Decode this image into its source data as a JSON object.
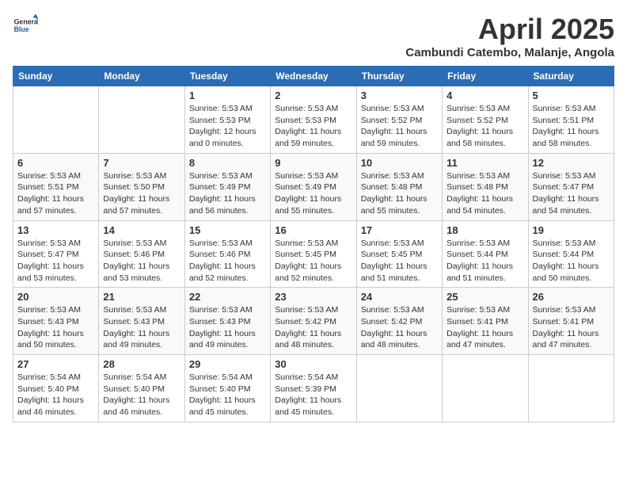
{
  "logo": {
    "general": "General",
    "blue": "Blue"
  },
  "title": "April 2025",
  "subtitle": "Cambundi Catembo, Malanje, Angola",
  "days_of_week": [
    "Sunday",
    "Monday",
    "Tuesday",
    "Wednesday",
    "Thursday",
    "Friday",
    "Saturday"
  ],
  "weeks": [
    [
      {
        "day": "",
        "sunrise": "",
        "sunset": "",
        "daylight": ""
      },
      {
        "day": "",
        "sunrise": "",
        "sunset": "",
        "daylight": ""
      },
      {
        "day": "1",
        "sunrise": "Sunrise: 5:53 AM",
        "sunset": "Sunset: 5:53 PM",
        "daylight": "Daylight: 12 hours and 0 minutes."
      },
      {
        "day": "2",
        "sunrise": "Sunrise: 5:53 AM",
        "sunset": "Sunset: 5:53 PM",
        "daylight": "Daylight: 11 hours and 59 minutes."
      },
      {
        "day": "3",
        "sunrise": "Sunrise: 5:53 AM",
        "sunset": "Sunset: 5:52 PM",
        "daylight": "Daylight: 11 hours and 59 minutes."
      },
      {
        "day": "4",
        "sunrise": "Sunrise: 5:53 AM",
        "sunset": "Sunset: 5:52 PM",
        "daylight": "Daylight: 11 hours and 58 minutes."
      },
      {
        "day": "5",
        "sunrise": "Sunrise: 5:53 AM",
        "sunset": "Sunset: 5:51 PM",
        "daylight": "Daylight: 11 hours and 58 minutes."
      }
    ],
    [
      {
        "day": "6",
        "sunrise": "Sunrise: 5:53 AM",
        "sunset": "Sunset: 5:51 PM",
        "daylight": "Daylight: 11 hours and 57 minutes."
      },
      {
        "day": "7",
        "sunrise": "Sunrise: 5:53 AM",
        "sunset": "Sunset: 5:50 PM",
        "daylight": "Daylight: 11 hours and 57 minutes."
      },
      {
        "day": "8",
        "sunrise": "Sunrise: 5:53 AM",
        "sunset": "Sunset: 5:49 PM",
        "daylight": "Daylight: 11 hours and 56 minutes."
      },
      {
        "day": "9",
        "sunrise": "Sunrise: 5:53 AM",
        "sunset": "Sunset: 5:49 PM",
        "daylight": "Daylight: 11 hours and 55 minutes."
      },
      {
        "day": "10",
        "sunrise": "Sunrise: 5:53 AM",
        "sunset": "Sunset: 5:48 PM",
        "daylight": "Daylight: 11 hours and 55 minutes."
      },
      {
        "day": "11",
        "sunrise": "Sunrise: 5:53 AM",
        "sunset": "Sunset: 5:48 PM",
        "daylight": "Daylight: 11 hours and 54 minutes."
      },
      {
        "day": "12",
        "sunrise": "Sunrise: 5:53 AM",
        "sunset": "Sunset: 5:47 PM",
        "daylight": "Daylight: 11 hours and 54 minutes."
      }
    ],
    [
      {
        "day": "13",
        "sunrise": "Sunrise: 5:53 AM",
        "sunset": "Sunset: 5:47 PM",
        "daylight": "Daylight: 11 hours and 53 minutes."
      },
      {
        "day": "14",
        "sunrise": "Sunrise: 5:53 AM",
        "sunset": "Sunset: 5:46 PM",
        "daylight": "Daylight: 11 hours and 53 minutes."
      },
      {
        "day": "15",
        "sunrise": "Sunrise: 5:53 AM",
        "sunset": "Sunset: 5:46 PM",
        "daylight": "Daylight: 11 hours and 52 minutes."
      },
      {
        "day": "16",
        "sunrise": "Sunrise: 5:53 AM",
        "sunset": "Sunset: 5:45 PM",
        "daylight": "Daylight: 11 hours and 52 minutes."
      },
      {
        "day": "17",
        "sunrise": "Sunrise: 5:53 AM",
        "sunset": "Sunset: 5:45 PM",
        "daylight": "Daylight: 11 hours and 51 minutes."
      },
      {
        "day": "18",
        "sunrise": "Sunrise: 5:53 AM",
        "sunset": "Sunset: 5:44 PM",
        "daylight": "Daylight: 11 hours and 51 minutes."
      },
      {
        "day": "19",
        "sunrise": "Sunrise: 5:53 AM",
        "sunset": "Sunset: 5:44 PM",
        "daylight": "Daylight: 11 hours and 50 minutes."
      }
    ],
    [
      {
        "day": "20",
        "sunrise": "Sunrise: 5:53 AM",
        "sunset": "Sunset: 5:43 PM",
        "daylight": "Daylight: 11 hours and 50 minutes."
      },
      {
        "day": "21",
        "sunrise": "Sunrise: 5:53 AM",
        "sunset": "Sunset: 5:43 PM",
        "daylight": "Daylight: 11 hours and 49 minutes."
      },
      {
        "day": "22",
        "sunrise": "Sunrise: 5:53 AM",
        "sunset": "Sunset: 5:43 PM",
        "daylight": "Daylight: 11 hours and 49 minutes."
      },
      {
        "day": "23",
        "sunrise": "Sunrise: 5:53 AM",
        "sunset": "Sunset: 5:42 PM",
        "daylight": "Daylight: 11 hours and 48 minutes."
      },
      {
        "day": "24",
        "sunrise": "Sunrise: 5:53 AM",
        "sunset": "Sunset: 5:42 PM",
        "daylight": "Daylight: 11 hours and 48 minutes."
      },
      {
        "day": "25",
        "sunrise": "Sunrise: 5:53 AM",
        "sunset": "Sunset: 5:41 PM",
        "daylight": "Daylight: 11 hours and 47 minutes."
      },
      {
        "day": "26",
        "sunrise": "Sunrise: 5:53 AM",
        "sunset": "Sunset: 5:41 PM",
        "daylight": "Daylight: 11 hours and 47 minutes."
      }
    ],
    [
      {
        "day": "27",
        "sunrise": "Sunrise: 5:54 AM",
        "sunset": "Sunset: 5:40 PM",
        "daylight": "Daylight: 11 hours and 46 minutes."
      },
      {
        "day": "28",
        "sunrise": "Sunrise: 5:54 AM",
        "sunset": "Sunset: 5:40 PM",
        "daylight": "Daylight: 11 hours and 46 minutes."
      },
      {
        "day": "29",
        "sunrise": "Sunrise: 5:54 AM",
        "sunset": "Sunset: 5:40 PM",
        "daylight": "Daylight: 11 hours and 45 minutes."
      },
      {
        "day": "30",
        "sunrise": "Sunrise: 5:54 AM",
        "sunset": "Sunset: 5:39 PM",
        "daylight": "Daylight: 11 hours and 45 minutes."
      },
      {
        "day": "",
        "sunrise": "",
        "sunset": "",
        "daylight": ""
      },
      {
        "day": "",
        "sunrise": "",
        "sunset": "",
        "daylight": ""
      },
      {
        "day": "",
        "sunrise": "",
        "sunset": "",
        "daylight": ""
      }
    ]
  ]
}
